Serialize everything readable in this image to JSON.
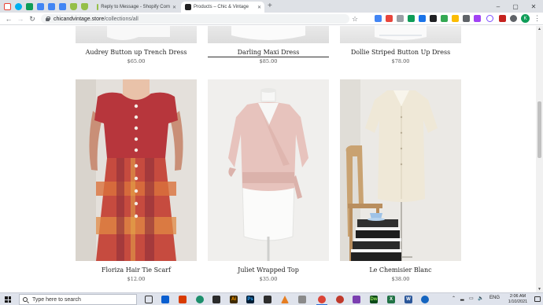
{
  "browser": {
    "pinned_tabs": [
      {
        "icon": "gmail-icon",
        "color": "#ea4335"
      },
      {
        "icon": "skype-icon",
        "color": "#00aff0"
      },
      {
        "icon": "google-sheets-icon",
        "color": "#0f9d58"
      },
      {
        "icon": "google-docs-icon",
        "color": "#4285f4"
      },
      {
        "icon": "google-docs-icon",
        "color": "#4285f4"
      },
      {
        "icon": "google-docs-icon",
        "color": "#4285f4"
      },
      {
        "icon": "shopify-icon",
        "color": "#95bf47"
      },
      {
        "icon": "shopify-icon",
        "color": "#95bf47"
      }
    ],
    "tabs": [
      {
        "title": "Reply to Message - Shopify Com",
        "icon": "shopify-icon",
        "active": false
      },
      {
        "title": "Products – Chic & Vintage",
        "icon": "store-favicon",
        "active": true
      }
    ],
    "url_host": "chicandvintage.store",
    "url_path": "/collections/all",
    "profile_initial": "K"
  },
  "products": [
    {
      "title": "Audrey Button up Trench Dress",
      "price": "$65.00"
    },
    {
      "title": "Darling Maxi Dress",
      "price": "$85.00",
      "hovered": true
    },
    {
      "title": "Dollie Striped Button Up Dress",
      "price": "$78.00"
    },
    {
      "title": "Floriza Hair Tie Scarf",
      "price": "$12.00"
    },
    {
      "title": "Juliet Wrapped Top",
      "price": "$35.00"
    },
    {
      "title": "Le Chemisier Blanc",
      "price": "$38.00"
    }
  ],
  "taskbar": {
    "search_placeholder": "Type here to search",
    "language": "ENG",
    "time": "2:06 AM",
    "date": "1/10/2021"
  }
}
